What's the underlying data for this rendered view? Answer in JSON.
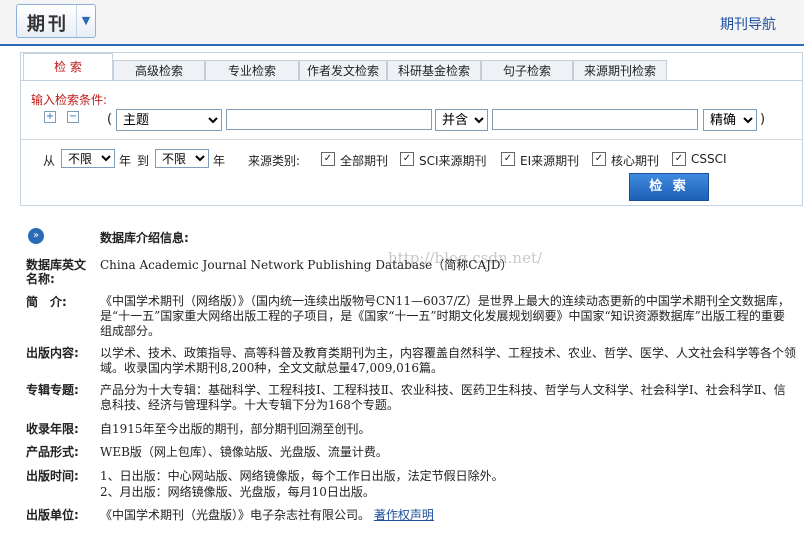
{
  "header": {
    "title": "期刊",
    "dropdown_icon": "chevron-down-icon",
    "nav_link": "期刊导航"
  },
  "tabs": [
    {
      "label": "检 索",
      "active": true
    },
    {
      "label": "高级检索"
    },
    {
      "label": "专业检索"
    },
    {
      "label": "作者发文检索"
    },
    {
      "label": "科研基金检索"
    },
    {
      "label": "句子检索"
    },
    {
      "label": "来源期刊检索"
    }
  ],
  "search": {
    "condition_label": "输入检索条件:",
    "add_icon": "+",
    "remove_icon": "−",
    "open_paren": "(",
    "close_paren": ")",
    "field_select": "主题",
    "logic_select": "并含",
    "match_select": "精确",
    "from_label": "从",
    "from_value": "不限",
    "year_label": "年",
    "to_label": "到",
    "to_value": "不限",
    "year_label2": "年",
    "source_label": "来源类别:",
    "sources": [
      {
        "label": "全部期刊",
        "checked": true
      },
      {
        "label": "SCI来源期刊",
        "checked": true
      },
      {
        "label": "EI来源期刊",
        "checked": true
      },
      {
        "label": "核心期刊",
        "checked": true
      },
      {
        "label": "CSSCI",
        "checked": true
      }
    ],
    "search_button": "检 索"
  },
  "info": {
    "title": "数据库介绍信息:",
    "watermark": "http://blog.csdn.net/",
    "rows": [
      {
        "label": "数据库英文名称:",
        "text": "China Academic Journal Network Publishing Database（简称CAJD）"
      },
      {
        "label": "简　介:",
        "text": "《中国学术期刊（网络版）》（国内统一连续出版物号CN11—6037/Z）是世界上最大的连续动态更新的中国学术期刊全文数据库，是“十一五”国家重大网络出版工程的子项目，是《国家“十一五”时期文化发展规划纲要》中国家“知识资源数据库”出版工程的重要组成部分。"
      },
      {
        "label": "出版内容:",
        "text": "以学术、技术、政策指导、高等科普及教育类期刊为主，内容覆盖自然科学、工程技术、农业、哲学、医学、人文社会科学等各个领域。收录国内学术期刊8,200种，全文文献总量47,009,016篇。"
      },
      {
        "label": "专辑专题:",
        "text": "产品分为十大专辑：基础科学、工程科技Ⅰ、工程科技Ⅱ、农业科技、医药卫生科技、哲学与人文科学、社会科学Ⅰ、社会科学Ⅱ、信息科技、经济与管理科学。十大专辑下分为168个专题。"
      },
      {
        "label": "收录年限:",
        "text": "自1915年至今出版的期刊，部分期刊回溯至创刊。"
      },
      {
        "label": "产品形式:",
        "text": "WEB版（网上包库）、镜像站版、光盘版、流量计费。"
      },
      {
        "label": "出版时间:",
        "text": "1、日出版：中心网站版、网络镜像版，每个工作日出版，法定节假日除外。",
        "text2": "2、月出版：网络镜像版、光盘版，每月10日出版。"
      },
      {
        "label": "出版单位:",
        "text": "《中国学术期刊（光盘版）》电子杂志社有限公司。",
        "link": "著作权声明"
      }
    ]
  }
}
